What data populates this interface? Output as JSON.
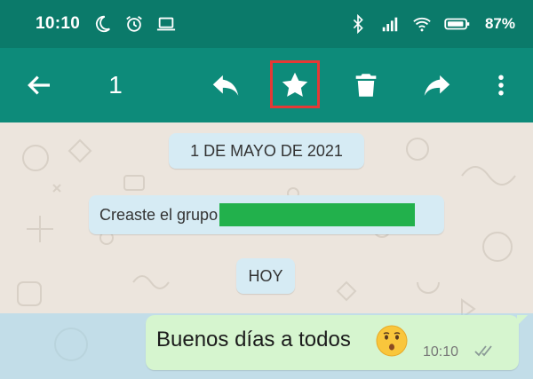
{
  "status_bar": {
    "time": "10:10",
    "battery": "87%",
    "left_icons": [
      "moon-icon",
      "alarm-icon",
      "laptop-icon"
    ],
    "right_icons": [
      "bluetooth-icon",
      "signal-icon",
      "wifi-icon",
      "battery-icon"
    ]
  },
  "toolbar": {
    "selected_count": "1",
    "actions": [
      "back-arrow-icon",
      "reply-icon",
      "star-icon",
      "delete-icon",
      "forward-icon",
      "more-icon"
    ],
    "highlight_color": "#e53935"
  },
  "chat": {
    "date_label": "1 DE MAYO DE 2021",
    "system_message_prefix": "Creaste el grupo",
    "today_label": "HOY",
    "message": {
      "text": "Buenos días a todos",
      "emoji": "kissing-face-emoji",
      "time": "10:10",
      "status": "double-check-icon"
    }
  },
  "colors": {
    "header": "#0d8b7a",
    "status_bar": "#0b7a6a",
    "outgoing_bubble": "#d6f5cf",
    "system_pill": "#d6ebf4",
    "redaction": "#22b14c"
  }
}
